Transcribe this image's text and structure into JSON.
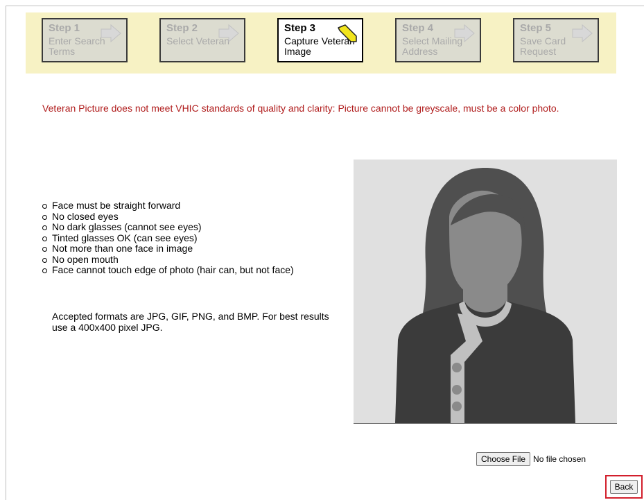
{
  "wizard": {
    "steps": [
      {
        "number": "Step 1",
        "description": "Enter Search Terms",
        "state": "inactive"
      },
      {
        "number": "Step 2",
        "description": "Select Veteran",
        "state": "inactive"
      },
      {
        "number": "Step 3",
        "description": "Capture Veteran Image",
        "state": "active"
      },
      {
        "number": "Step 4",
        "description": "Select Mailing Address",
        "state": "inactive"
      },
      {
        "number": "Step 5",
        "description": "Save Card Request",
        "state": "inactive"
      }
    ],
    "colors": {
      "banner": "#f7f2c4",
      "active_arrow": "#f2e51c",
      "inactive_arrow": "#c9c9c9"
    }
  },
  "error": {
    "message": "Veteran Picture does not meet VHIC standards of quality and clarity: Picture cannot be greyscale, must be a color photo.",
    "color": "#b01c1c"
  },
  "requirements": [
    "Face must be straight forward",
    "No closed eyes",
    "No dark glasses (cannot see eyes)",
    "Tinted glasses OK (can see eyes)",
    "Not more than one face in image",
    "No open mouth",
    "Face cannot touch edge of photo (hair can, but not face)"
  ],
  "formats_note": "Accepted formats are JPG, GIF, PNG, and BMP. For best results use a 400x400 pixel JPG.",
  "photo": {
    "icon": "silhouette-placeholder-icon"
  },
  "upload": {
    "button_label": "Choose File",
    "status": "No file chosen"
  },
  "actions": {
    "back_label": "Back",
    "highlight_color": "#d21f2c"
  }
}
